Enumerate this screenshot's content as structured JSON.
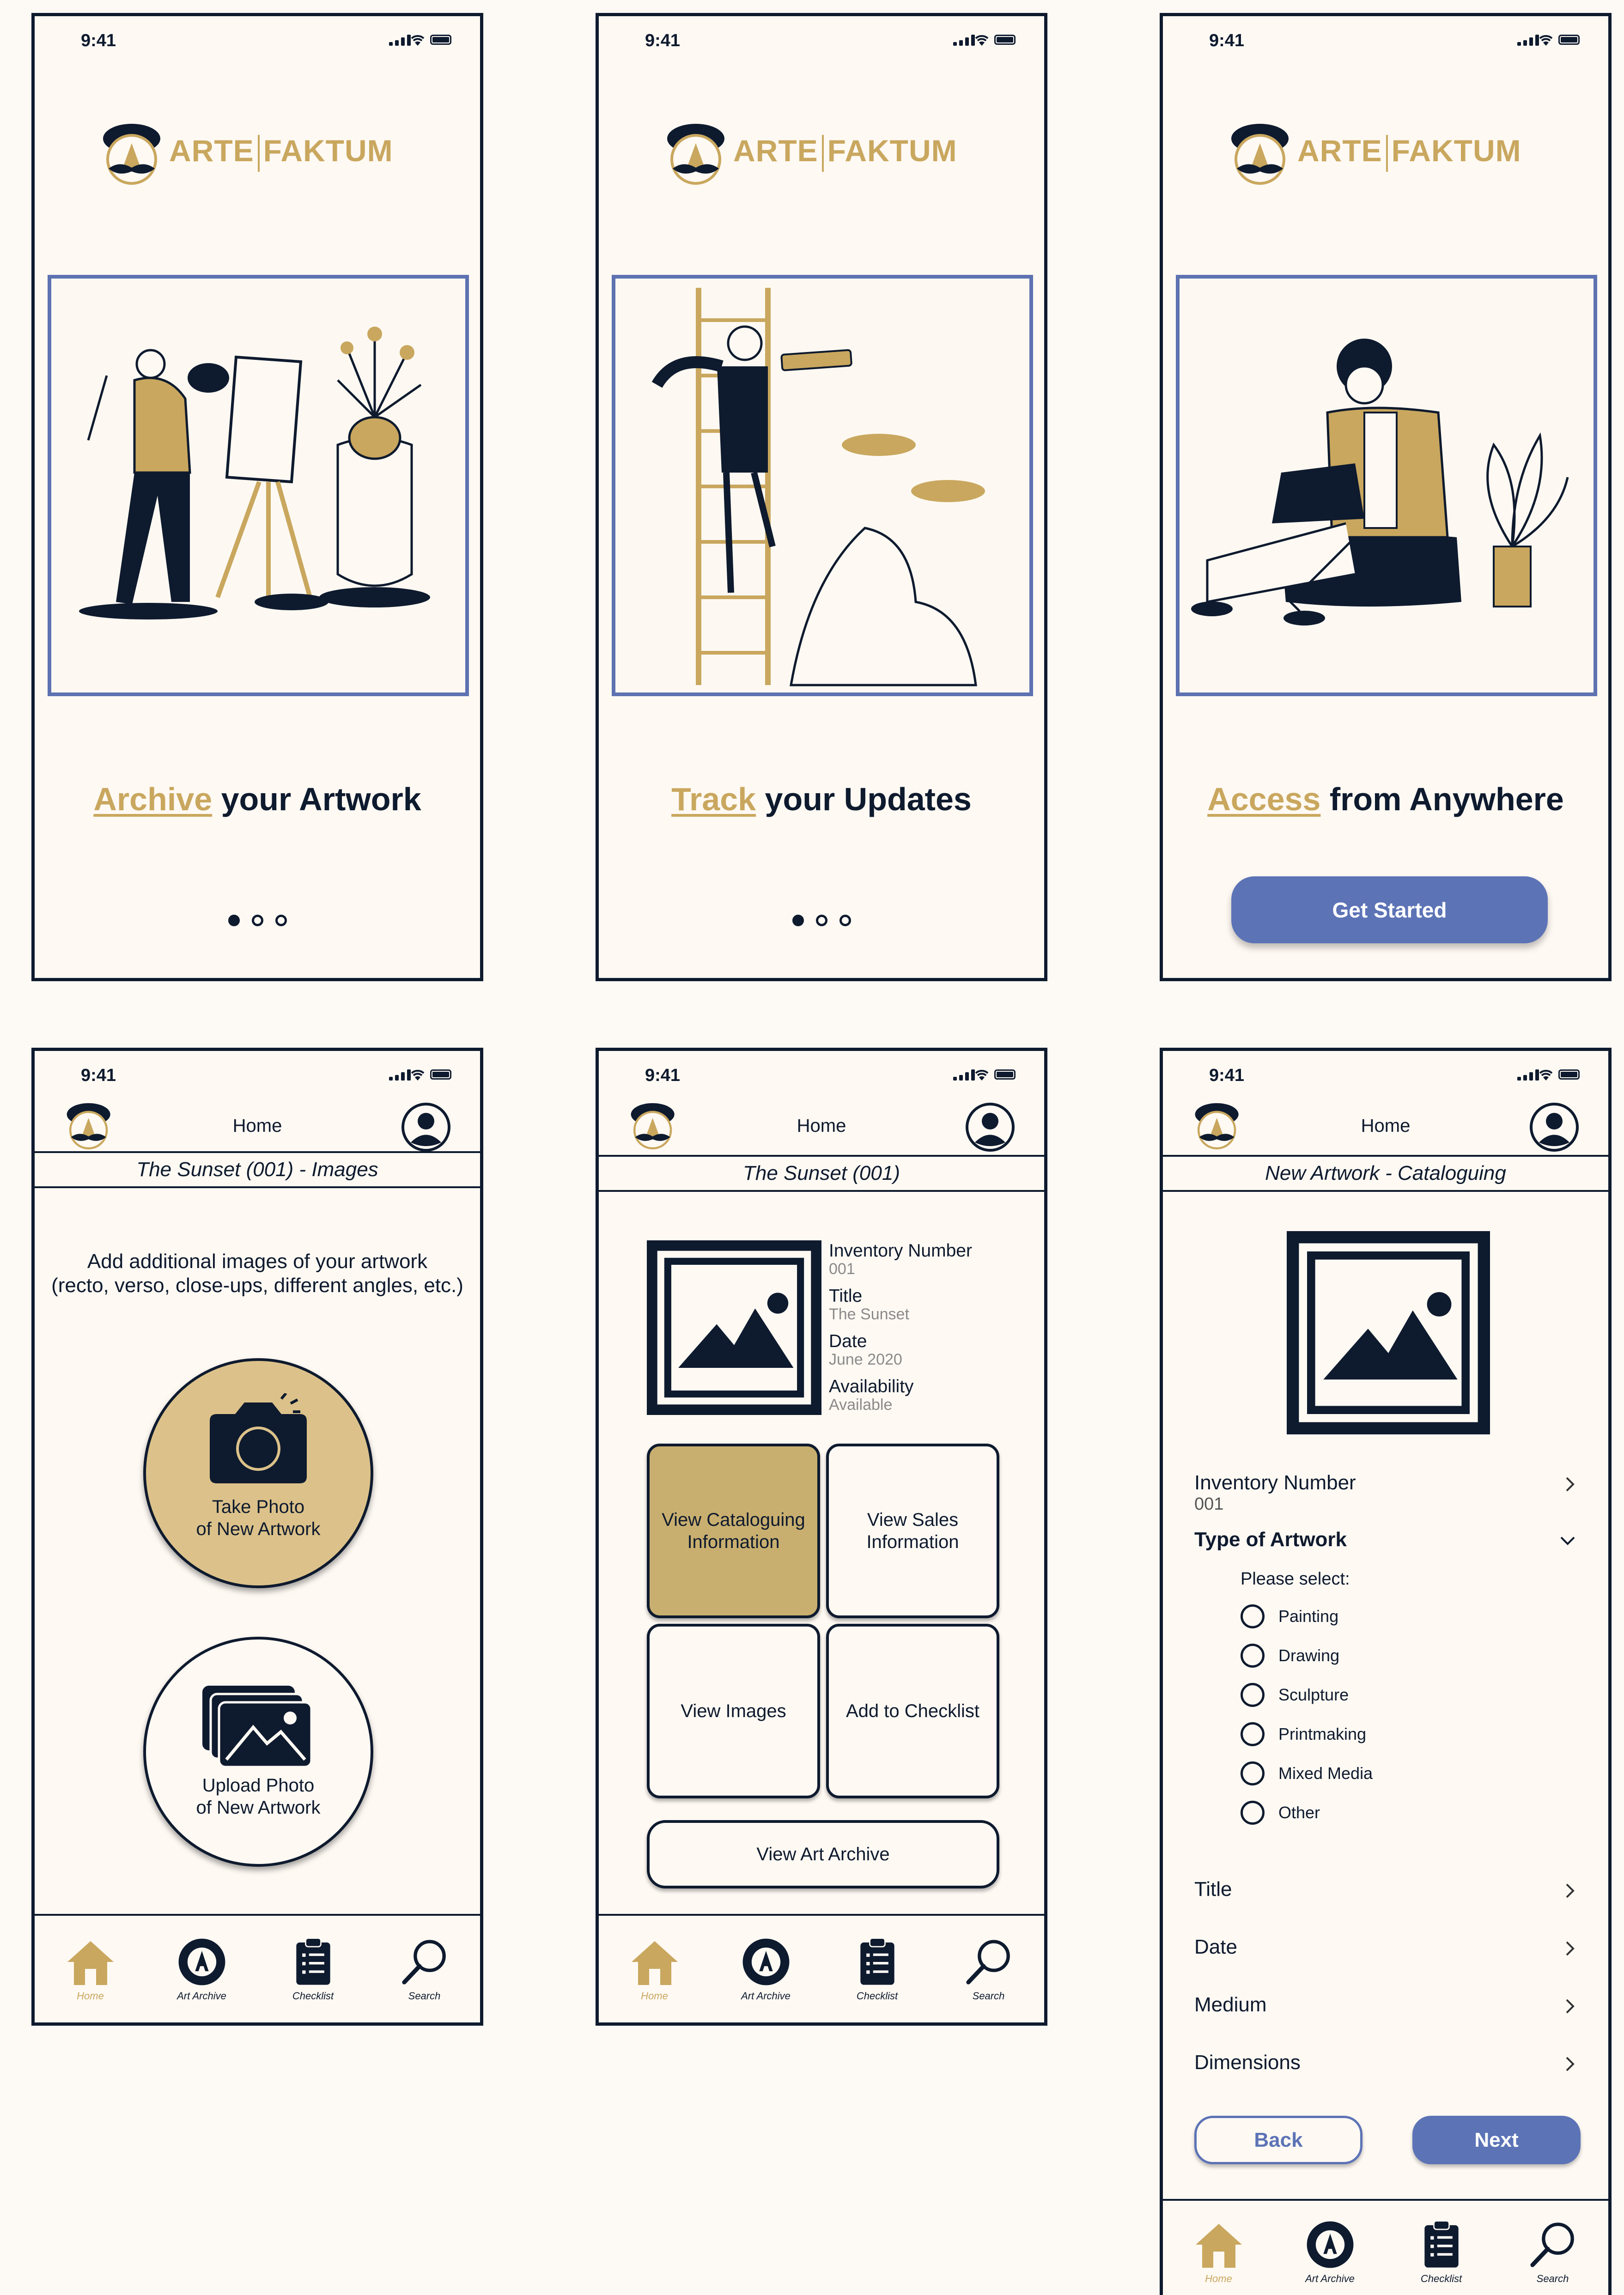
{
  "status": {
    "time": "9:41"
  },
  "brand": {
    "name_left": "ARTE",
    "name_right": "FAKTUM"
  },
  "colors": {
    "gold": "#c9a75e",
    "navy": "#0e1a2e",
    "blue": "#5c73b6",
    "cream": "#fef9f3"
  },
  "onboarding": [
    {
      "highlight": "Archive",
      "rest": " your Artwork"
    },
    {
      "highlight": "Track",
      "rest": " your Updates"
    },
    {
      "highlight": "Access",
      "rest": " from Anywhere",
      "cta": "Get Started"
    }
  ],
  "header": {
    "title": "Home"
  },
  "images_screen": {
    "subtitle": "The Sunset (001) - Images",
    "intro_line1": "Add additional images of your artwork",
    "intro_line2": "(recto, verso, close-ups, different angles, etc.)",
    "take_line1": "Take Photo",
    "take_line2": "of New Artwork",
    "upload_line1": "Upload Photo",
    "upload_line2": "of New Artwork"
  },
  "detail_screen": {
    "subtitle": "The Sunset (001)",
    "fields": [
      {
        "label": "Inventory Number",
        "value": "001"
      },
      {
        "label": "Title",
        "value": "The Sunset"
      },
      {
        "label": "Date",
        "value": "June 2020"
      },
      {
        "label": "Availability",
        "value": "Available"
      }
    ],
    "cards": [
      "View Cataloguing Information",
      "View Sales Information",
      "View Images",
      "Add to Checklist"
    ],
    "archive_button": "View Art Archive"
  },
  "catalog_screen": {
    "subtitle": "New Artwork - Cataloguing",
    "inventory_label": "Inventory Number",
    "inventory_value": "001",
    "type_label": "Type of Artwork",
    "please_select": "Please select:",
    "options": [
      "Painting",
      "Drawing",
      "Sculpture",
      "Printmaking",
      "Mixed Media",
      "Other"
    ],
    "rows": [
      "Title",
      "Date",
      "Medium",
      "Dimensions"
    ],
    "back": "Back",
    "next": "Next"
  },
  "tabs": [
    "Home",
    "Art Archive",
    "Checklist",
    "Search"
  ]
}
